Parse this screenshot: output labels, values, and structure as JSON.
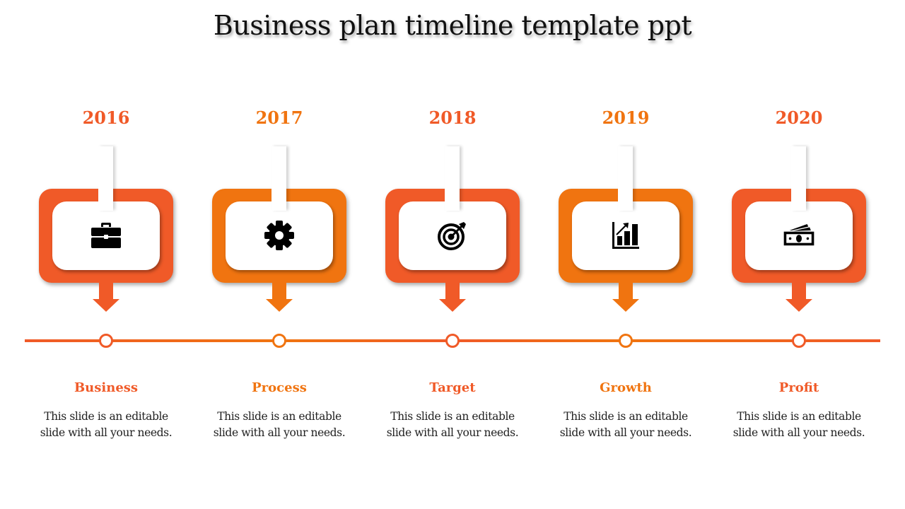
{
  "title": "Business plan timeline template ppt",
  "colors": {
    "red_orange": "#F05A28",
    "amber_orange": "#F07410",
    "icon": "#000000",
    "body_text": "#222222"
  },
  "stages": [
    {
      "year": "2016",
      "icon": "briefcase-icon",
      "label": "Business",
      "description": "This slide is an editable slide with all your needs.",
      "color": "#F05A28"
    },
    {
      "year": "2017",
      "icon": "gear-icon",
      "label": "Process",
      "description": "This slide is an editable slide with all your needs.",
      "color": "#F07410"
    },
    {
      "year": "2018",
      "icon": "target-icon",
      "label": "Target",
      "description": "This slide is an editable slide with all your needs.",
      "color": "#F05A28"
    },
    {
      "year": "2019",
      "icon": "growth-chart-icon",
      "label": "Growth",
      "description": "This slide is an editable slide with all your needs.",
      "color": "#F07410"
    },
    {
      "year": "2020",
      "icon": "money-icon",
      "label": "Profit",
      "description": "This slide is an editable slide with all your needs.",
      "color": "#F05A28"
    }
  ]
}
